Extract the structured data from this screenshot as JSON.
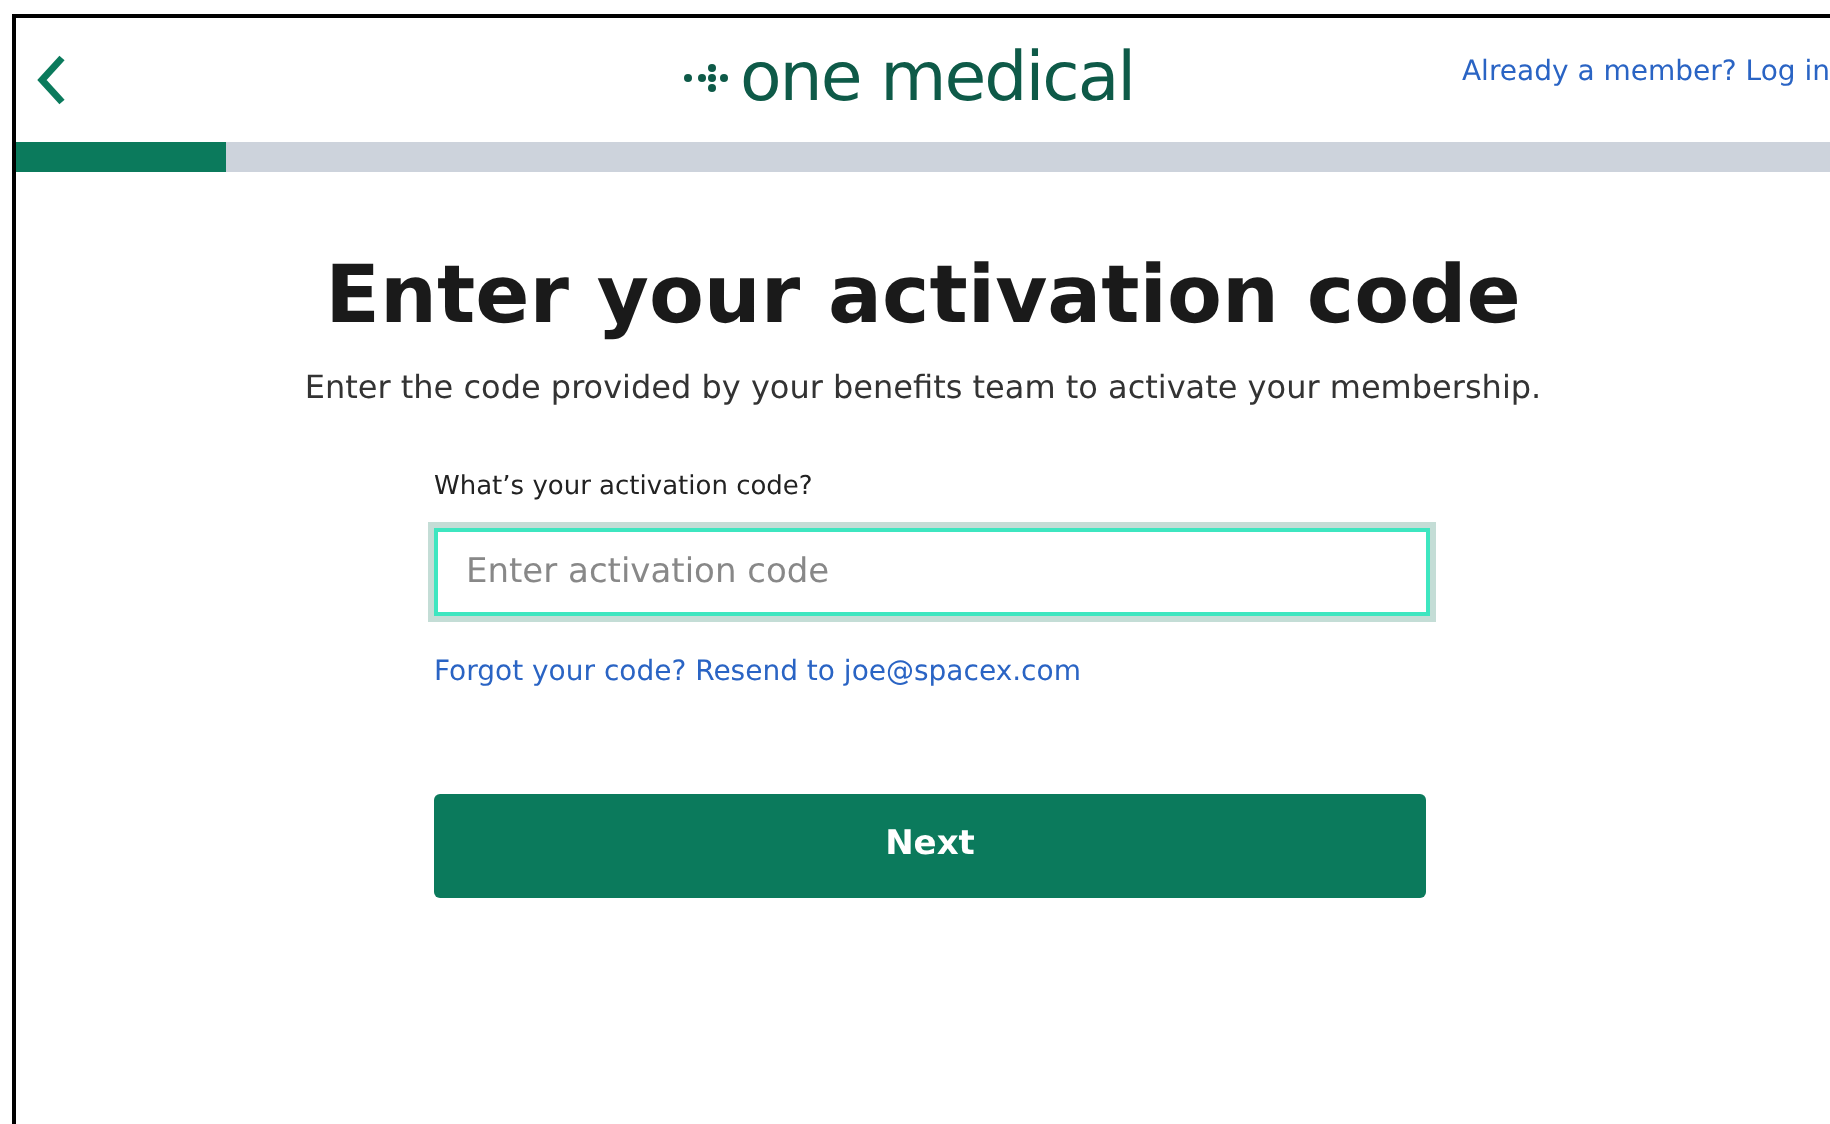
{
  "header": {
    "logo_text": "one medical",
    "login_link": "Already a member? Log in"
  },
  "progress": {
    "level": 0.116
  },
  "title": "Enter your activation code",
  "subtitle": "Enter the code provided by your benefits team to activate your membership.",
  "field": {
    "label": "What’s your activation code?",
    "placeholder": "Enter activation code",
    "focused": true
  },
  "resend_link": "Forgot your code? Resend to joe@spacex.com",
  "next_button": "Next"
}
